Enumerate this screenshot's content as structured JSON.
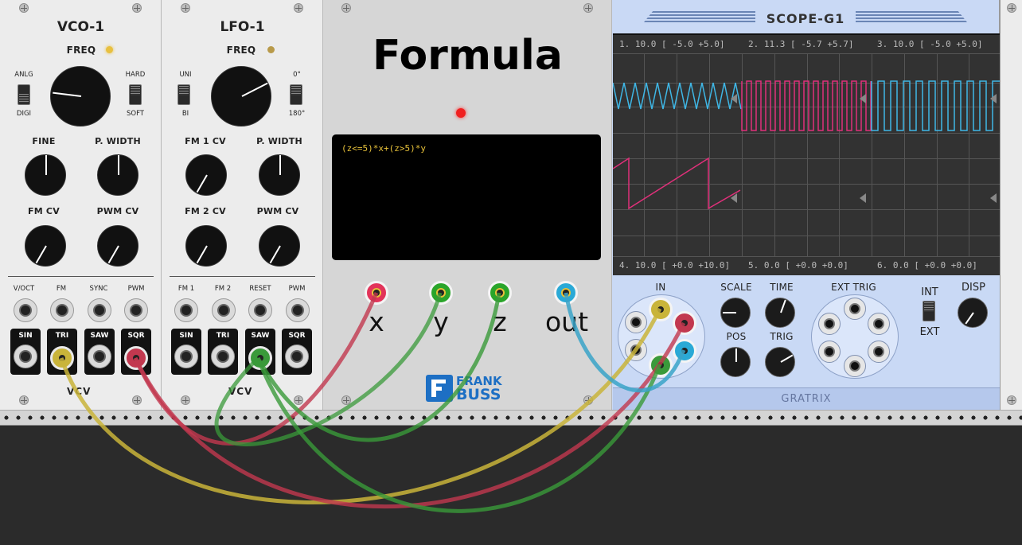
{
  "vco": {
    "title": "VCO-1",
    "freq": "FREQ",
    "anlg": "ANLG",
    "digi": "DIGI",
    "hard": "HARD",
    "soft": "SOFT",
    "fine": "FINE",
    "pwidth": "P. WIDTH",
    "fmcv": "FM CV",
    "pwmcv": "PWM CV",
    "inputs": [
      "V/OCT",
      "FM",
      "SYNC",
      "PWM"
    ],
    "outputs": [
      "SIN",
      "TRI",
      "SAW",
      "SQR"
    ],
    "brand": "VCV"
  },
  "lfo": {
    "title": "LFO-1",
    "freq": "FREQ",
    "uni": "UNI",
    "bi": "BI",
    "deg0": "0°",
    "deg180": "180°",
    "fm1cv": "FM 1 CV",
    "pwidth": "P. WIDTH",
    "fm2cv": "FM 2 CV",
    "pwmcv": "PWM CV",
    "inputs": [
      "FM 1",
      "FM 2",
      "RESET",
      "PWM"
    ],
    "outputs": [
      "SIN",
      "TRI",
      "SAW",
      "SQR"
    ],
    "brand": "VCV"
  },
  "formula": {
    "title": "Formula",
    "expression": "(z<=5)*x+(z>5)*y",
    "ports": [
      "x",
      "y",
      "z",
      "out"
    ],
    "brand_line1": "FRANK",
    "brand_line2": "BUSS",
    "colors": {
      "x": "#e2345a",
      "y": "#2aa52a",
      "z": "#2aa52a",
      "out": "#2aa9d6"
    }
  },
  "scope": {
    "title": "SCOPE-G1",
    "ch_top": [
      "1. 10.0 [ -5.0  +5.0]",
      "2. 11.3 [ -5.7  +5.7]",
      "3. 10.0 [ -5.0  +5.0]"
    ],
    "ch_bottom": [
      "4. 10.0 [ +0.0 +10.0]",
      "5.  0.0 [ +0.0  +0.0]",
      "6.  0.0 [ +0.0  +0.0]"
    ],
    "in": "IN",
    "scale": "SCALE",
    "time": "TIME",
    "pos": "POS",
    "trig": "TRIG",
    "ext_trig": "EXT TRIG",
    "int": "INT",
    "ext": "EXT",
    "disp": "DISP",
    "brand": "GRATRIX",
    "trace_colors": {
      "ch1": "#3fb7e6",
      "ch2": "#e0307a",
      "ch3": "#3fb7e6",
      "ch4": "#e0307a"
    }
  },
  "cables": {
    "yellow": "#c9b43a",
    "red": "#c2384f",
    "green": "#3a9a3a",
    "blue": "#3aa3c8",
    "pink": "#d05a7a"
  }
}
